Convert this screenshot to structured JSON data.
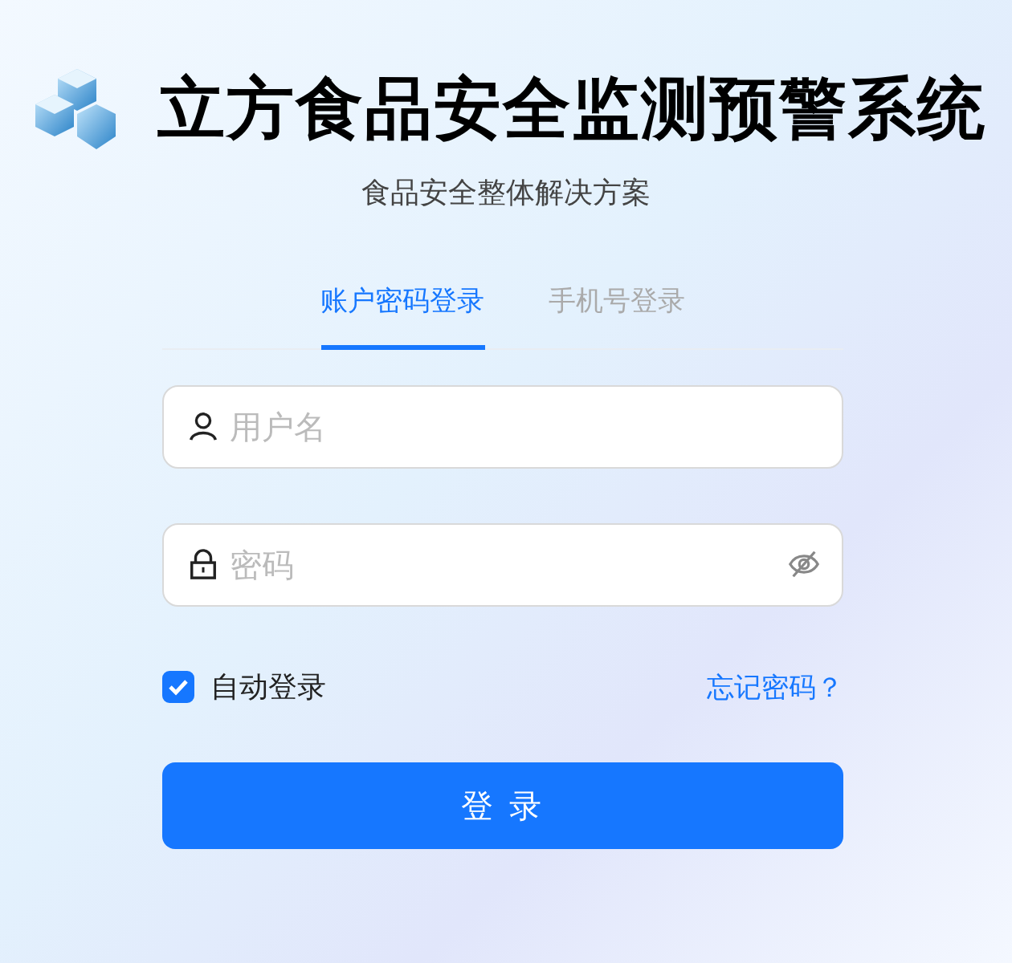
{
  "header": {
    "title": "立方食品安全监测预警系统",
    "subtitle": "食品安全整体解决方案"
  },
  "tabs": [
    {
      "label": "账户密码登录",
      "selected": true
    },
    {
      "label": "手机号登录",
      "selected": false
    }
  ],
  "fields": [
    {
      "kind": "username",
      "placeholder": "用户名"
    },
    {
      "kind": "password",
      "placeholder": "密码"
    }
  ],
  "auto_login": {
    "label": "自动登录",
    "checked": true
  },
  "forgot_link": "忘记密码？",
  "login_button": "登 录"
}
